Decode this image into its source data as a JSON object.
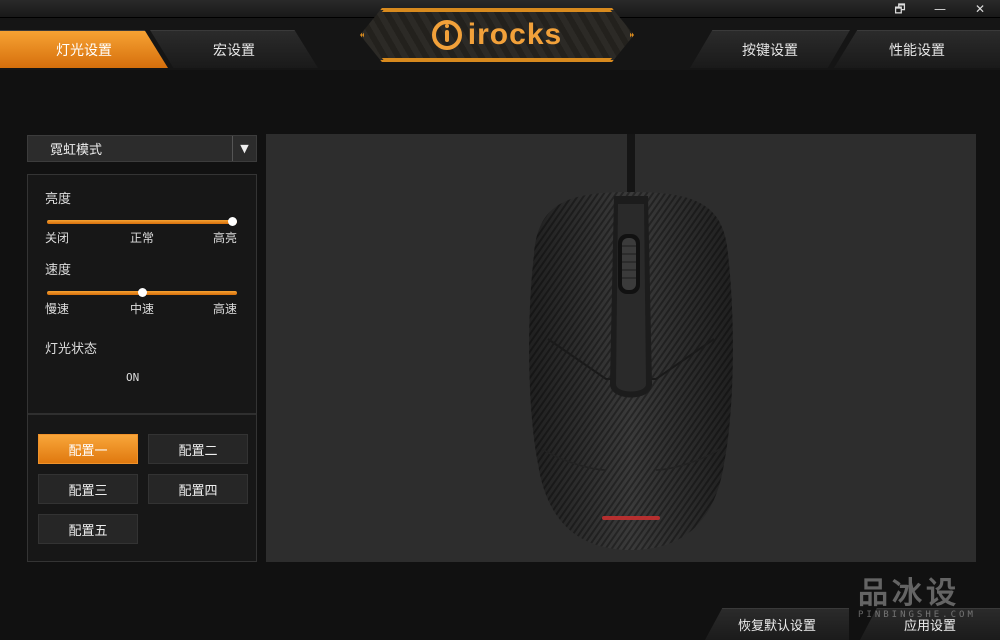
{
  "tabs": [
    {
      "label": "灯光设置",
      "active": true
    },
    {
      "label": "宏设置",
      "active": false
    },
    {
      "label": "按键设置",
      "active": false
    },
    {
      "label": "性能设置",
      "active": false
    }
  ],
  "brand": {
    "name": "irocks",
    "accent": "#f2a13a"
  },
  "window_controls": {
    "restore": "🗗",
    "minimize": "—",
    "close": "✕"
  },
  "light_mode": {
    "selected": "霓虹模式"
  },
  "brightness": {
    "label": "亮度",
    "ticks": [
      "关闭",
      "正常",
      "高亮"
    ],
    "value": 1.0
  },
  "speed": {
    "label": "速度",
    "ticks": [
      "慢速",
      "中速",
      "高速"
    ],
    "value": 0.5
  },
  "light_status": {
    "label": "灯光状态",
    "value": "ON"
  },
  "profiles": [
    {
      "label": "配置一",
      "active": true
    },
    {
      "label": "配置二",
      "active": false
    },
    {
      "label": "配置三",
      "active": false
    },
    {
      "label": "配置四",
      "active": false
    },
    {
      "label": "配置五",
      "active": false
    }
  ],
  "footer": {
    "reset": "恢复默认设置",
    "apply": "应用设置"
  },
  "watermark": {
    "big": "品冰设",
    "small": "PINBINGSHE.COM"
  },
  "colors": {
    "accent": "#f39a2a",
    "panel": "#171717",
    "preview_bg": "#2d2d2d"
  }
}
